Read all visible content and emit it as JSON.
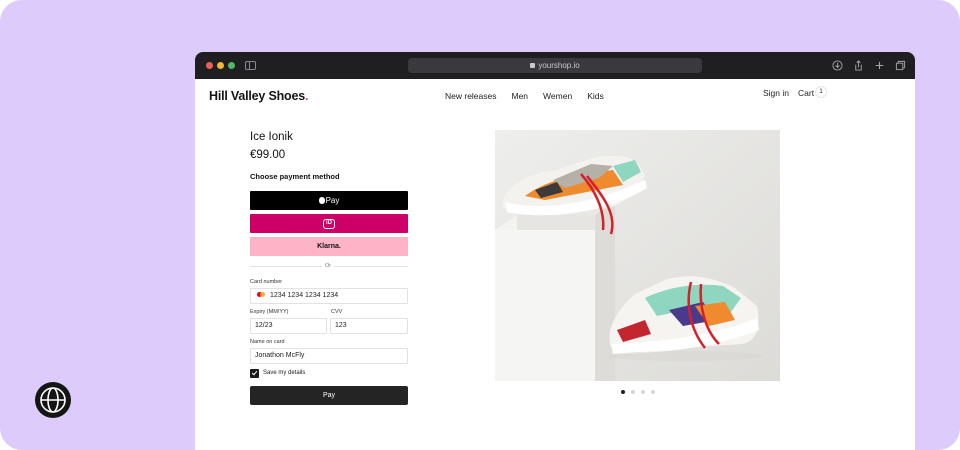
{
  "browser": {
    "url": "yourshop.io"
  },
  "nav": {
    "logo": "Hill Valley Shoes",
    "logo_dot": ".",
    "menu": [
      "New releases",
      "Men",
      "Wemen",
      "Kids"
    ],
    "sign_in": "Sign in",
    "cart": "Cart",
    "cart_count": "1"
  },
  "product": {
    "title": "Ice Ionik",
    "price": "€99.00",
    "payment_heading": "Choose payment method"
  },
  "payment_methods": {
    "apple_pay": "Pay",
    "ideal": "iD",
    "klarna": "Klarna."
  },
  "form": {
    "or_label": "Or",
    "card_number_label": "Card number",
    "card_number": "1234 1234 1234 1234",
    "expiry_label": "Expiry (MM/YY)",
    "expiry": "12/23",
    "cvv_label": "CVV",
    "cvv": "123",
    "name_label": "Name on card",
    "name": "Jonathon McFly",
    "save_details": "Save my details",
    "save_checked": true,
    "pay_button": "Pay"
  },
  "carousel": {
    "total": 4,
    "active": 1
  },
  "colors": {
    "page_bg": "#dccbfb",
    "ideal": "#cc0066",
    "klarna": "#ffb3c7",
    "apple_pay": "#000000",
    "pay_button": "#242424"
  }
}
